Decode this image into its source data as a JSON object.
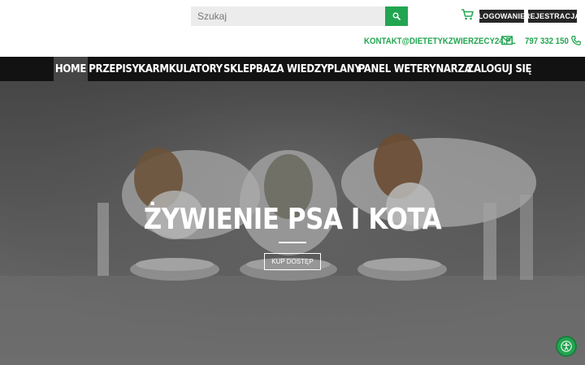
{
  "search": {
    "placeholder": "Szukaj"
  },
  "header": {
    "login_label": "LOGOWANIE",
    "register_label": "REJESTRACJA",
    "email": "KONTAKT@DIETETYKZWIERZECY24.PL",
    "phone": "797 332 150"
  },
  "icons": [
    "search-icon",
    "cart-icon",
    "mail-icon",
    "phone-icon",
    "accessibility-icon"
  ],
  "colors": {
    "accent": "#22a550",
    "nav_bg": "#121212",
    "nav_active": "#454545",
    "button_dark": "#262626"
  },
  "nav": {
    "items": [
      {
        "label": "HOME"
      },
      {
        "label": "PRZEPISY"
      },
      {
        "label": "KARMKULATORY"
      },
      {
        "label": "SKLEP"
      },
      {
        "label": "BAZA WIEDZY"
      },
      {
        "label": "PLANY"
      },
      {
        "label": "PANEL WETERYNARZA"
      },
      {
        "label": "ZALOGUJ SIĘ"
      }
    ]
  },
  "hero": {
    "title": "ŻYWIENIE PSA I KOTA",
    "button_label": "KUP DOSTĘP"
  }
}
